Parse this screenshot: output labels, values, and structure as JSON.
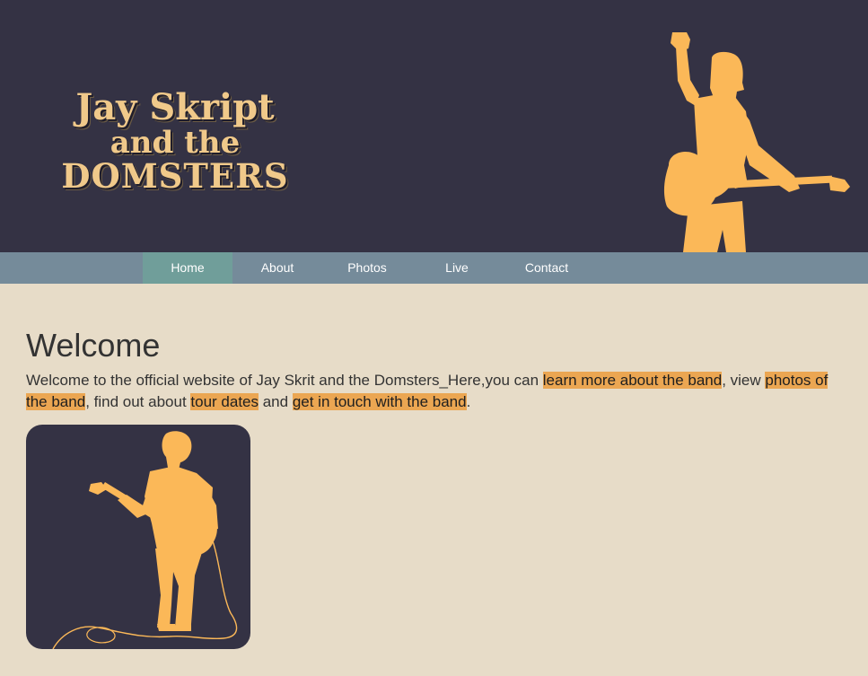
{
  "header": {
    "logo_line1": "Jay Skript",
    "logo_line2": "and the",
    "logo_line3": "DOMSTERS",
    "figure_icon": "guitarist-silhouette"
  },
  "nav": {
    "items": [
      {
        "label": "Home",
        "active": true
      },
      {
        "label": "About",
        "active": false
      },
      {
        "label": "Photos",
        "active": false
      },
      {
        "label": "Live",
        "active": false
      },
      {
        "label": "Contact",
        "active": false
      }
    ]
  },
  "main": {
    "title": "Welcome",
    "intro_part1": "Welcome to the official website of Jay Skrit and the Domsters_Here,you can ",
    "link_about": "learn more about the band",
    "intro_part2": ", view ",
    "link_photos": "photos of the band",
    "intro_part3": ", find out about ",
    "link_live": "tour dates",
    "intro_part4": " and ",
    "link_contact": "get in touch with the band",
    "intro_part5": ".",
    "photo_icon": "guitarist-silhouette"
  },
  "colors": {
    "header_bg": "#343244",
    "logo_text": "#f0c98a",
    "silhouette": "#fbb858",
    "nav_bg": "#758b9a",
    "nav_active": "#709e9a",
    "page_bg": "#e7dcc8",
    "link_highlight": "#eba652"
  }
}
